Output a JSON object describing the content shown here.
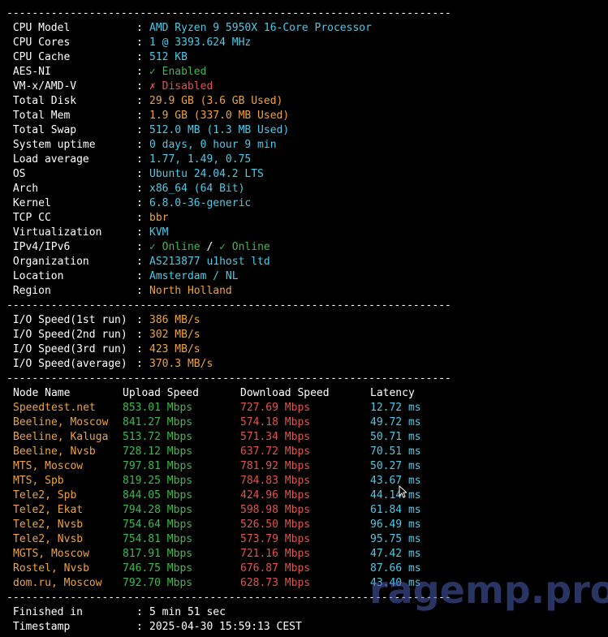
{
  "separator": "----------------------------------------------------------------------",
  "sysinfo": [
    {
      "label": " CPU Model",
      "value": "AMD Ryzen 9 5950X 16-Core Processor",
      "color": "cyan"
    },
    {
      "label": " CPU Cores",
      "value": "1 @ 3393.624 MHz",
      "color": "cyan"
    },
    {
      "label": " CPU Cache",
      "value": "512 KB",
      "color": "cyan"
    },
    {
      "label": " AES-NI",
      "value": "✓ Enabled",
      "color": "green"
    },
    {
      "label": " VM-x/AMD-V",
      "value": "✗ Disabled",
      "color": "red"
    },
    {
      "label": " Total Disk",
      "value": "29.9 GB (3.6 GB Used)",
      "color": "orange"
    },
    {
      "label": " Total Mem",
      "value": "1.9 GB (337.0 MB Used)",
      "color": "orange"
    },
    {
      "label": " Total Swap",
      "value": "512.0 MB (1.3 MB Used)",
      "color": "cyan"
    },
    {
      "label": " System uptime",
      "value": "0 days, 0 hour 9 min",
      "color": "cyan"
    },
    {
      "label": " Load average",
      "value": "1.77, 1.49, 0.75",
      "color": "cyan"
    },
    {
      "label": " OS",
      "value": "Ubuntu 24.04.2 LTS",
      "color": "cyan"
    },
    {
      "label": " Arch",
      "value": "x86_64 (64 Bit)",
      "color": "cyan"
    },
    {
      "label": " Kernel",
      "value": "6.8.0-36-generic",
      "color": "cyan"
    },
    {
      "label": " TCP CC",
      "value": "bbr",
      "color": "orange"
    },
    {
      "label": " Virtualization",
      "value": "KVM",
      "color": "cyan"
    },
    {
      "label": " IPv4/IPv6",
      "value": "✓ Online",
      "value2": "✓ Online",
      "slash": " / ",
      "color": "green"
    },
    {
      "label": " Organization",
      "value": "AS213877 u1host ltd",
      "color": "cyan"
    },
    {
      "label": " Location",
      "value": "Amsterdam / NL",
      "color": "cyan"
    },
    {
      "label": " Region",
      "value": "North Holland",
      "color": "orange"
    }
  ],
  "io": [
    {
      "label": " I/O Speed(1st run)",
      "value": "386 MB/s"
    },
    {
      "label": " I/O Speed(2nd run)",
      "value": "302 MB/s"
    },
    {
      "label": " I/O Speed(3rd run)",
      "value": "423 MB/s"
    },
    {
      "label": " I/O Speed(average)",
      "value": "370.3 MB/s"
    }
  ],
  "speedtest": {
    "headers": [
      "Node Name",
      "Upload Speed",
      "Download Speed",
      "Latency"
    ],
    "rows": [
      [
        "Speedtest.net",
        "853.01 Mbps",
        "727.69 Mbps",
        "12.72 ms"
      ],
      [
        "Beeline, Moscow",
        "841.27 Mbps",
        "574.18 Mbps",
        "49.72 ms"
      ],
      [
        "Beeline, Kaluga",
        "513.72 Mbps",
        "571.34 Mbps",
        "50.71 ms"
      ],
      [
        "Beeline, Nvsb",
        "728.12 Mbps",
        "637.72 Mbps",
        "70.51 ms"
      ],
      [
        "MTS, Moscow",
        "797.81 Mbps",
        "781.92 Mbps",
        "50.27 ms"
      ],
      [
        "MTS, Spb",
        "819.25 Mbps",
        "784.83 Mbps",
        "43.67 ms"
      ],
      [
        "Tele2, Spb",
        "844.05 Mbps",
        "424.96 Mbps",
        "44.14 ms"
      ],
      [
        "Tele2, Ekat",
        "794.28 Mbps",
        "598.98 Mbps",
        "61.84 ms"
      ],
      [
        "Tele2, Nvsb",
        "754.64 Mbps",
        "526.50 Mbps",
        "96.49 ms"
      ],
      [
        "Tele2, Nvsb",
        "754.81 Mbps",
        "573.79 Mbps",
        "95.75 ms"
      ],
      [
        "MGTS, Moscow",
        "817.91 Mbps",
        "721.16 Mbps",
        "47.42 ms"
      ],
      [
        "Rostel, Nvsb",
        "746.75 Mbps",
        "676.87 Mbps",
        "87.66 ms"
      ],
      [
        "dom.ru, Moscow",
        "792.70 Mbps",
        "628.73 Mbps",
        "43.40 ms"
      ]
    ]
  },
  "footer": [
    {
      "label": " Finished in",
      "value": "5 min 51 sec"
    },
    {
      "label": " Timestamp",
      "value": "2025-04-30 15:59:13 CEST"
    }
  ],
  "colon": ":",
  "watermark": "ragemp.pro",
  "colors": {
    "cyan": "#4ec9e8",
    "green": "#3fb950",
    "red": "#e5534b",
    "orange": "#f0a33a",
    "background": "#000000"
  },
  "cursor_icon": "mouse-pointer-icon"
}
